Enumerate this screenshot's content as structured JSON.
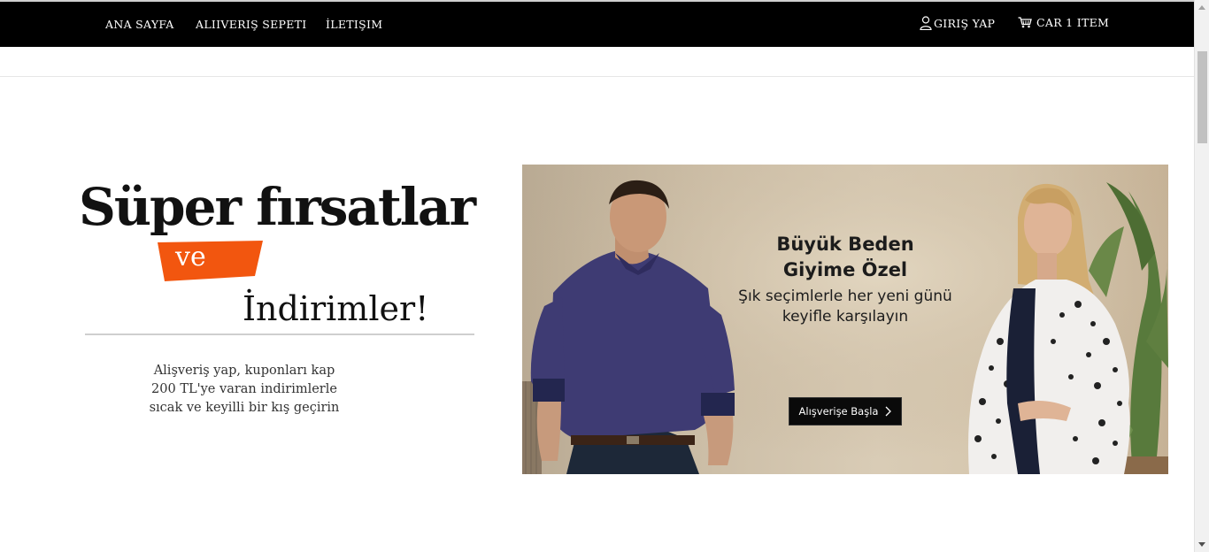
{
  "nav": {
    "home": "ANA SAYFA",
    "shopping_cart": "ALIIVERIŞ SEPETI",
    "contact": "İLETIŞIM",
    "login": "GIRIŞ YAP",
    "cart_items": "CAR 1 ITEM",
    "login_icon": "user-icon",
    "cart_icon": "shopping-cart-icon"
  },
  "hero": {
    "title": "Süper fırsatlar",
    "connector": "ve",
    "subtitle": "İndirimler!",
    "description": [
      "Alişveriş yap, kuponları kap",
      "200 TL'ye varan indirimlerle",
      "sıcak ve keyilli bir kış geçirin"
    ],
    "accent_color": "#f2560f"
  },
  "banner": {
    "title_lines": [
      "Büyük Beden",
      "Giyime Özel"
    ],
    "text_lines": [
      "Şık seçimlerle her yeni günü",
      "keyifle karşılayın"
    ],
    "button_label": "Alışverişe Başla",
    "button_icon": "chevron-right-icon"
  }
}
